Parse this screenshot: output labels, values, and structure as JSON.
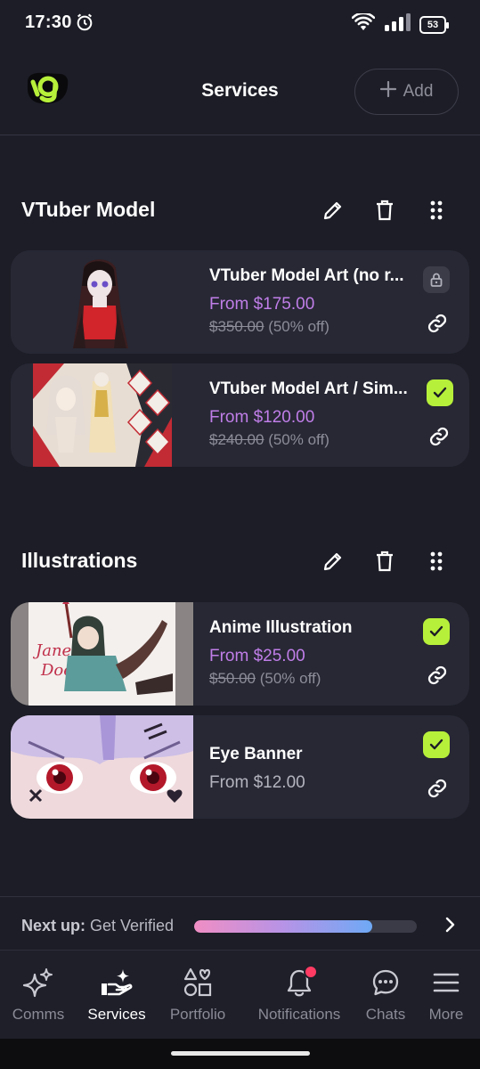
{
  "status_bar": {
    "time": "17:30",
    "battery": "53"
  },
  "app_bar": {
    "title": "Services",
    "add_label": "Add"
  },
  "sections": [
    {
      "title": "VTuber Model",
      "items": [
        {
          "name": "VTuber Model Art (no r...",
          "price": "From $175.00",
          "original_price": "$350.00",
          "discount": "(50% off)",
          "status": "locked"
        },
        {
          "name": "VTuber Model Art / Sim...",
          "price": "From $120.00",
          "original_price": "$240.00",
          "discount": "(50% off)",
          "status": "active"
        }
      ]
    },
    {
      "title": "Illustrations",
      "items": [
        {
          "name": "Anime Illustration",
          "price": "From $25.00",
          "original_price": "$50.00",
          "discount": "(50% off)",
          "status": "active"
        },
        {
          "name": "Eye Banner",
          "price": "From $12.00",
          "status": "active"
        }
      ]
    }
  ],
  "next_up": {
    "label": "Next up:",
    "value": "Get Verified",
    "progress": 0.8
  },
  "bottom_nav": [
    {
      "label": "Comms",
      "icon": "sparkles-icon"
    },
    {
      "label": "Services",
      "icon": "hand-sparkle-icon",
      "active": true
    },
    {
      "label": "Portfolio",
      "icon": "shapes-icon"
    },
    {
      "label": "Notifications",
      "icon": "bell-icon",
      "has_badge": true
    },
    {
      "label": "Chats",
      "icon": "chat-bubble-icon"
    },
    {
      "label": "More",
      "icon": "menu-icon"
    }
  ],
  "colors": {
    "background": "#1c1d26",
    "card": "#272834",
    "accent_purple": "#c07ee8",
    "accent_green": "#b7f03a",
    "notification": "#ff3b63"
  }
}
